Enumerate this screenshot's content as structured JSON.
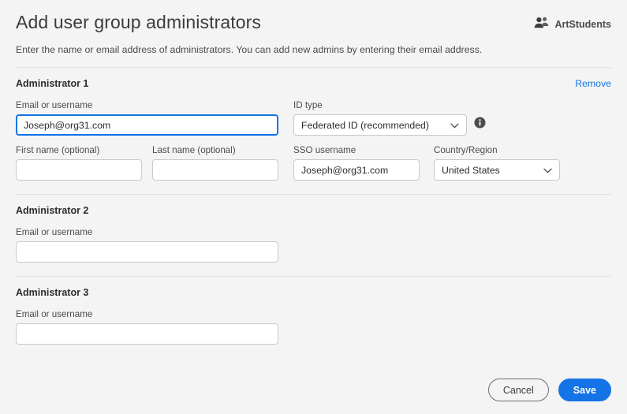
{
  "header": {
    "title": "Add user group administrators",
    "org_label": "ArtStudents",
    "org_icon": "users-icon",
    "subtitle": "Enter the name or email address of administrators. You can add new admins by entering their email address."
  },
  "labels": {
    "email_or_username": "Email or username",
    "id_type": "ID type",
    "first_name": "First name (optional)",
    "last_name": "Last name (optional)",
    "sso_username": "SSO username",
    "country_region": "Country/Region",
    "remove": "Remove",
    "info_icon": "info-icon",
    "chevron_icon": "chevron-down-icon"
  },
  "administrators": [
    {
      "title": "Administrator 1",
      "remove_label": "Remove",
      "email_value": "Joseph@org31.com",
      "email_placeholder": "",
      "id_type_value": "Federated ID (recommended)",
      "first_name_value": "",
      "first_name_placeholder": "",
      "last_name_value": "",
      "last_name_placeholder": "",
      "sso_username_value": "Joseph@org31.com",
      "country_value": "United States"
    },
    {
      "title": "Administrator 2",
      "email_value": "",
      "email_placeholder": ""
    },
    {
      "title": "Administrator 3",
      "email_value": "",
      "email_placeholder": ""
    }
  ],
  "footer": {
    "cancel_label": "Cancel",
    "save_label": "Save"
  },
  "colors": {
    "accent": "#1473e6",
    "page_background": "#f4f4f4",
    "field_border": "#c9c9c9",
    "divider": "#e1e1e1",
    "text": "#2c2c2c"
  }
}
